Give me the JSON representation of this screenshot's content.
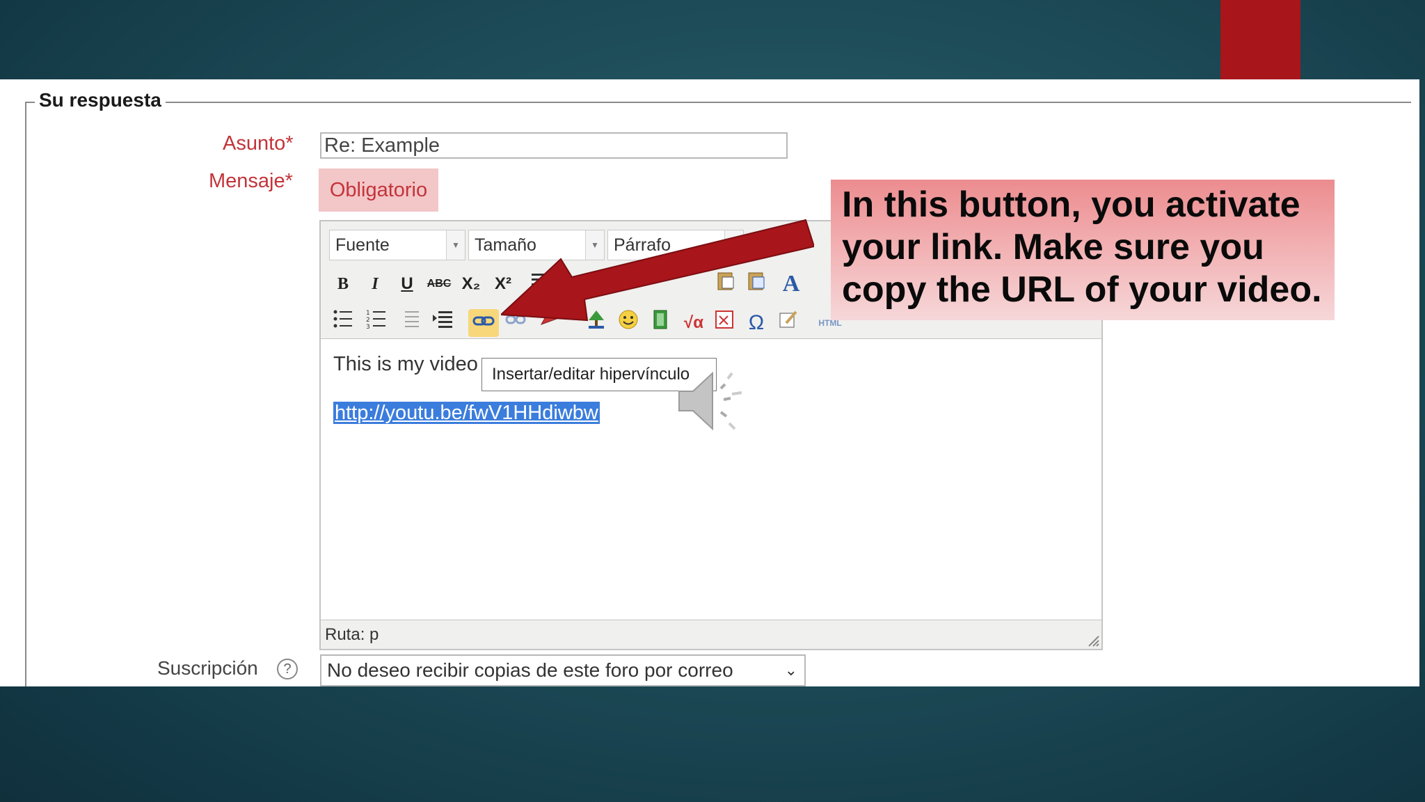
{
  "form": {
    "legend": "Su respuesta",
    "subject_label": "Asunto",
    "message_label": "Mensaje",
    "required_mark": "*",
    "subject_value": "Re: Example",
    "required_badge": "Obligatorio",
    "subscription_label": "Suscripción",
    "help_glyph": "?",
    "subscription_value": "No deseo recibir copias de este foro por correo"
  },
  "editor": {
    "font_select": "Fuente",
    "size_select": "Tamaño",
    "format_select": "Párrafo",
    "content_line1": "This is my video",
    "content_link": "http://youtu.be/fwV1HHdiwbw",
    "path": "Ruta: p",
    "tooltip": "Insertar/editar hipervínculo",
    "toolbar_row1": {
      "bold": "B",
      "italic": "I",
      "underline": "U",
      "strike": "ABC",
      "subscript": "X₂",
      "superscript": "X²",
      "text_color": "A"
    },
    "toolbar_row2": {
      "special_char": "Ω",
      "html": "HTML"
    }
  },
  "callout": {
    "text": "In this button, you activate your link. Make sure you copy the URL of your video."
  },
  "colors": {
    "accent_red": "#a8151a",
    "arrow_red": "#a8151a",
    "label_red": "#c3343a",
    "selection_blue": "#3b7ddd"
  },
  "icons": [
    "bullet-list-icon",
    "numbered-list-icon",
    "outdent-icon",
    "indent-icon",
    "link-icon",
    "unlink-icon",
    "anchor-icon",
    "image-icon",
    "emoticon-icon",
    "media-icon",
    "equation-icon",
    "table-icon",
    "special-char-icon",
    "edit-icon",
    "html-icon",
    "speaker-icon",
    "arrow-icon"
  ]
}
